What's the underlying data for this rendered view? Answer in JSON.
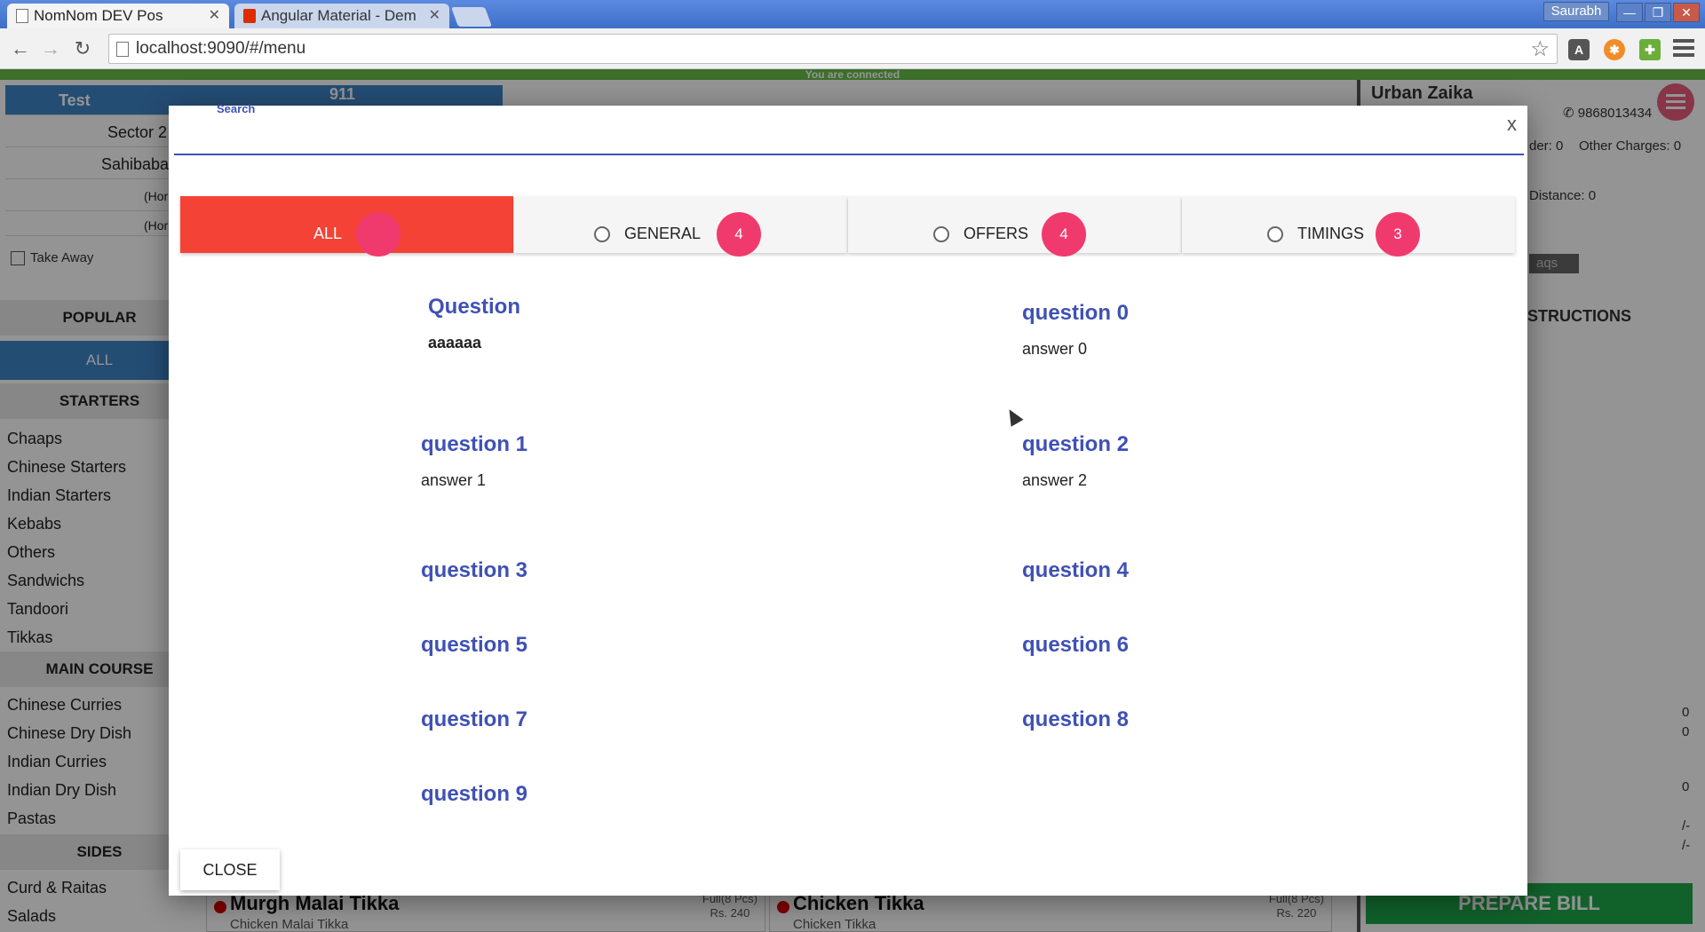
{
  "browser": {
    "tabs": [
      {
        "title": "NomNom DEV Pos"
      },
      {
        "title": "Angular Material - Dem"
      }
    ],
    "user": "Saurabh",
    "url": "localhost:9090/#/menu",
    "window_buttons": {
      "minimize": "—",
      "restore": "❐",
      "close": "✕"
    }
  },
  "status": {
    "connected": "You are connected"
  },
  "background": {
    "customer": {
      "name": "Test",
      "number": "911"
    },
    "address_rows": [
      "Sector 2",
      "Sahibaba",
      "(Hor",
      "(Hor"
    ],
    "take_away": "Take Away",
    "categories": {
      "popular": "POPULAR",
      "all": "ALL",
      "starters": "STARTERS",
      "starter_items": [
        "Chaaps",
        "Chinese Starters",
        "Indian Starters",
        "Kebabs",
        "Others",
        "Sandwichs",
        "Tandoori",
        "Tikkas"
      ],
      "main_course": "MAIN COURSE",
      "main_items": [
        "Chinese Curries",
        "Chinese Dry Dish",
        "Indian Curries",
        "Indian Dry Dish",
        "Pastas"
      ],
      "sides": "SIDES",
      "side_items": [
        "Curd & Raitas",
        "Salads"
      ]
    },
    "restaurant": {
      "name": "Urban Zaika",
      "phone": "9868013434"
    },
    "order_info": {
      "order_label": "der: 0",
      "other_charges": "Other Charges: 0",
      "distance": "Distance: 0",
      "faqs": "aqs"
    },
    "instructions": "STRUCTIONS",
    "right_values": [
      "0",
      "0",
      "0",
      "/-",
      "/-"
    ],
    "prepare_bill": "PREPARE BILL",
    "food_cards": [
      {
        "name": "Murgh Malai Tikka",
        "sub": "Chicken Malai Tikka",
        "portion": "Full(8 Pcs)",
        "price": "Rs. 240"
      },
      {
        "name": "Chicken Tikka",
        "sub": "Chicken Tikka",
        "portion": "Full(8 Pcs)",
        "price": "Rs. 220"
      }
    ]
  },
  "dialog": {
    "search_label": "Search",
    "search_value": "",
    "close_x": "x",
    "tabs": [
      {
        "label": "ALL",
        "badge": ""
      },
      {
        "label": "GENERAL",
        "badge": "4"
      },
      {
        "label": "OFFERS",
        "badge": "4"
      },
      {
        "label": "TIMINGS",
        "badge": "3"
      }
    ],
    "faqs": [
      {
        "question": "Question",
        "answer": "aaaaaa"
      },
      {
        "question": "question 0",
        "answer": "answer 0"
      },
      {
        "question": "question 1",
        "answer": "answer 1"
      },
      {
        "question": "question 2",
        "answer": "answer 2"
      },
      {
        "question": "question 3",
        "answer": ""
      },
      {
        "question": "question 4",
        "answer": ""
      },
      {
        "question": "question 5",
        "answer": ""
      },
      {
        "question": "question 6",
        "answer": ""
      },
      {
        "question": "question 7",
        "answer": ""
      },
      {
        "question": "question 8",
        "answer": ""
      },
      {
        "question": "question 9",
        "answer": ""
      }
    ],
    "close_button": "CLOSE"
  },
  "colors": {
    "accent": "#3f51b5",
    "active_tab": "#f44336",
    "badge": "#f03a6e",
    "connected_bar": "#6abf4b",
    "prepare_bill": "#1ea84a"
  }
}
